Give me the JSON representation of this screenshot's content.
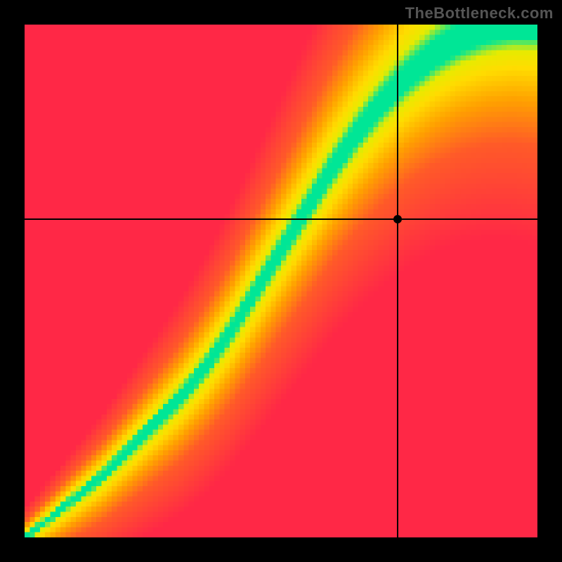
{
  "watermark": "TheBottleneck.com",
  "chart_data": {
    "type": "heatmap",
    "title": "",
    "xlabel": "",
    "ylabel": "",
    "xlim": [
      0,
      1
    ],
    "ylim": [
      0,
      1
    ],
    "grid": false,
    "legend": false,
    "crosshair": {
      "x": 0.728,
      "y": 0.62
    },
    "marker": {
      "x": 0.728,
      "y": 0.62
    },
    "ideal_curve_points": [
      {
        "x": 0.0,
        "y": 0.0
      },
      {
        "x": 0.05,
        "y": 0.04
      },
      {
        "x": 0.1,
        "y": 0.08
      },
      {
        "x": 0.15,
        "y": 0.12
      },
      {
        "x": 0.2,
        "y": 0.17
      },
      {
        "x": 0.25,
        "y": 0.22
      },
      {
        "x": 0.3,
        "y": 0.27
      },
      {
        "x": 0.35,
        "y": 0.33
      },
      {
        "x": 0.4,
        "y": 0.4
      },
      {
        "x": 0.45,
        "y": 0.48
      },
      {
        "x": 0.5,
        "y": 0.56
      },
      {
        "x": 0.55,
        "y": 0.64
      },
      {
        "x": 0.6,
        "y": 0.72
      },
      {
        "x": 0.65,
        "y": 0.79
      },
      {
        "x": 0.7,
        "y": 0.85
      },
      {
        "x": 0.75,
        "y": 0.9
      },
      {
        "x": 0.8,
        "y": 0.94
      },
      {
        "x": 0.85,
        "y": 0.97
      },
      {
        "x": 0.9,
        "y": 0.99
      },
      {
        "x": 0.95,
        "y": 1.0
      },
      {
        "x": 1.0,
        "y": 1.0
      }
    ],
    "color_scale_note": "green (optimal) -> yellow -> orange -> red (bottleneck)",
    "pixelated": true,
    "resolution_cells": 100
  }
}
